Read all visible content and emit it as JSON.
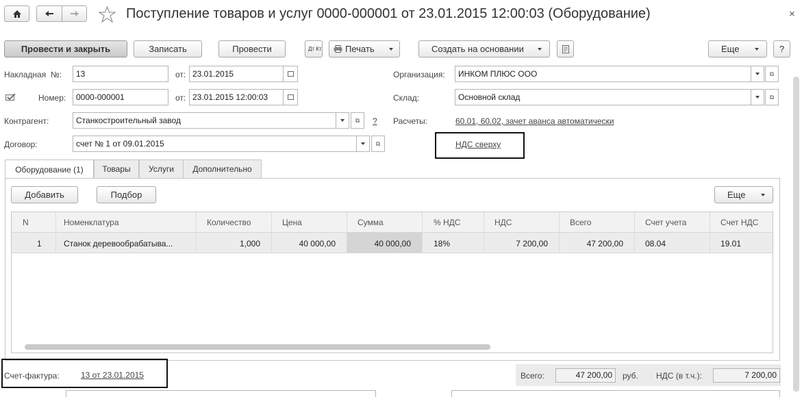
{
  "title": "Поступление товаров и услуг 0000-000001 от 23.01.2015 12:00:03 (Оборудование)",
  "toolbar": {
    "post_close": "Провести и закрыть",
    "save": "Записать",
    "post": "Провести",
    "dtkt": "Дт Кт",
    "print": "Печать",
    "create_based": "Создать на основании",
    "more": "Еще",
    "help": "?"
  },
  "form": {
    "invoice_label": "Накладная  №:",
    "invoice_number": "13",
    "from_label": "от:",
    "invoice_date": "23.01.2015",
    "number_label": "Номер:",
    "number": "0000-000001",
    "doc_date": "23.01.2015 12:00:03",
    "org_label": "Организация:",
    "org": "ИНКОМ ПЛЮС ООО",
    "warehouse_label": "Склад:",
    "warehouse": "Основной склад",
    "contractor_label": "Контрагент:",
    "contractor": "Станкостроительный завод",
    "contractor_help": "?",
    "settlements_label": "Расчеты:",
    "settlements": "60.01, 60.02, зачет аванса автоматически",
    "contract_label": "Договор:",
    "contract": "счет № 1 от 09.01.2015",
    "vat_link": "НДС сверху"
  },
  "tabs": [
    "Оборудование (1)",
    "Товары",
    "Услуги",
    "Дополнительно"
  ],
  "table_toolbar": {
    "add": "Добавить",
    "select": "Подбор",
    "more": "Еще"
  },
  "table": {
    "headers": [
      "N",
      "Номенклатура",
      "Количество",
      "Цена",
      "Сумма",
      "% НДС",
      "НДС",
      "Всего",
      "Счет учета",
      "Счет НДС"
    ],
    "rows": [
      [
        "1",
        "Станок деревообрабатыва...",
        "1,000",
        "40 000,00",
        "40 000,00",
        "18%",
        "7 200,00",
        "47 200,00",
        "08.04",
        "19.01"
      ]
    ]
  },
  "footer": {
    "invoice_label": "Счет-фактура:",
    "invoice_link": "13 от 23.01.2015",
    "total_label": "Всего:",
    "total": "47 200,00",
    "currency": "руб.",
    "vat_label": "НДС (в т.ч.):",
    "vat": "7 200,00"
  }
}
